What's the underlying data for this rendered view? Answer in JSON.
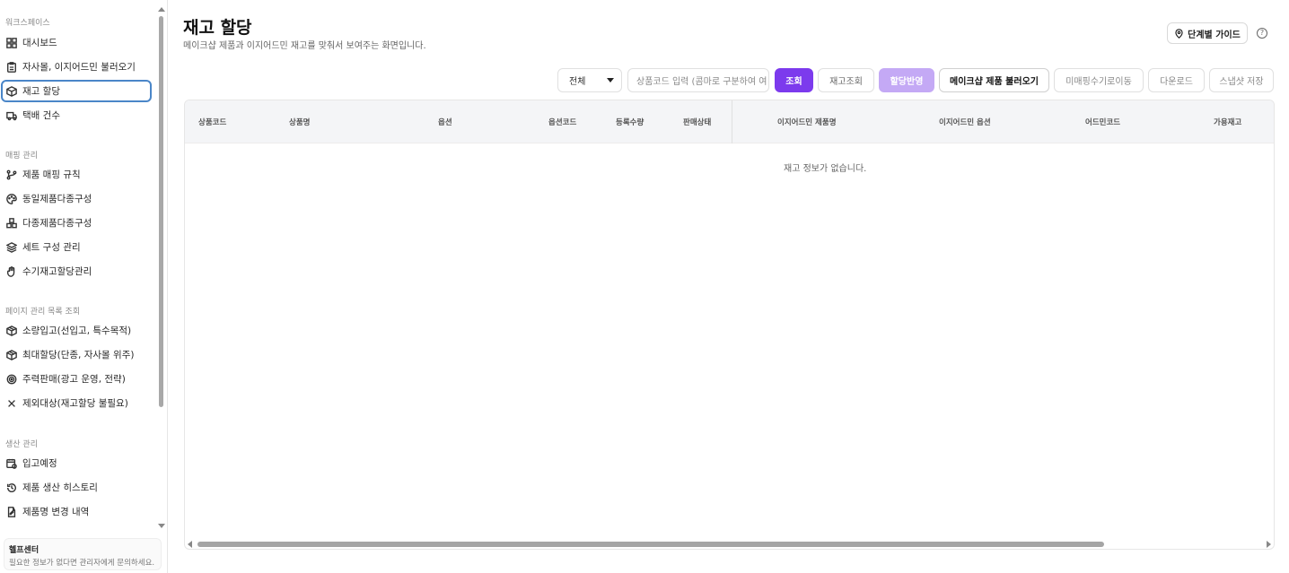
{
  "sidebar": {
    "sections": [
      {
        "label": "워크스페이스",
        "items": [
          {
            "label": "대시보드",
            "icon": "dashboard-icon"
          },
          {
            "label": "자사몰, 이지어드민 불러오기",
            "icon": "clipboard-icon"
          },
          {
            "label": "재고 할당",
            "icon": "box-icon",
            "active": true
          },
          {
            "label": "택배 건수",
            "icon": "truck-icon"
          }
        ]
      },
      {
        "label": "매핑 관리",
        "items": [
          {
            "label": "제품 매핑 규칙",
            "icon": "branch-icon"
          },
          {
            "label": "동일제품다종구성",
            "icon": "palette-icon"
          },
          {
            "label": "다종제품다종구성",
            "icon": "boxes-icon"
          },
          {
            "label": "세트 구성 관리",
            "icon": "layers-icon"
          },
          {
            "label": "수기재고할당관리",
            "icon": "hand-icon"
          }
        ]
      },
      {
        "label": "페이지 관리 목록 조회",
        "items": [
          {
            "label": "소량입고(선입고, 특수목적)",
            "icon": "package-icon"
          },
          {
            "label": "최대할당(단종, 자사몰 위주)",
            "icon": "package-icon"
          },
          {
            "label": "주력판매(광고 운영, 전략)",
            "icon": "target-icon"
          },
          {
            "label": "제외대상(재고할당 불필요)",
            "icon": "x-icon"
          }
        ]
      },
      {
        "label": "생산 관리",
        "items": [
          {
            "label": "입고예정",
            "icon": "calendar-clock-icon"
          },
          {
            "label": "제품 생산 히스토리",
            "icon": "history-icon"
          },
          {
            "label": "제품명 변경 내역",
            "icon": "edit-doc-icon"
          }
        ]
      }
    ],
    "help": {
      "title": "헬프센터",
      "desc": "필요한 정보가 없다면 관리자에게 문의하세요."
    }
  },
  "header": {
    "title": "재고 할당",
    "subtitle": "메이크샵 제품과 이지어드민 재고를 맞춰서 보여주는 화면입니다.",
    "guide_label": "단계별 가이드",
    "help_icon": "?"
  },
  "toolbar": {
    "filter_value": "전체",
    "search_placeholder": "상품코드 입력 (콤마로 구분하여 여",
    "query_label": "조회",
    "stock_label": "재고조회",
    "reflect_label": "할당반영",
    "load_label": "메이크샵 제품 불러오기",
    "move_label": "미매핑수기로이동",
    "download_label": "다운로드",
    "snapshot_label": "스냅샷 저장",
    "colors": {
      "primary": "#7c3aed",
      "primary_disabled": "#c4a9f5"
    }
  },
  "table": {
    "columns": [
      "상품코드",
      "상품명",
      "옵션",
      "옵션코드",
      "등록수량",
      "판매상태",
      "이지어드민 제품명",
      "이지어드민 옵션",
      "어드민코드",
      "가용재고"
    ],
    "empty_text": "재고 정보가 없습니다."
  }
}
